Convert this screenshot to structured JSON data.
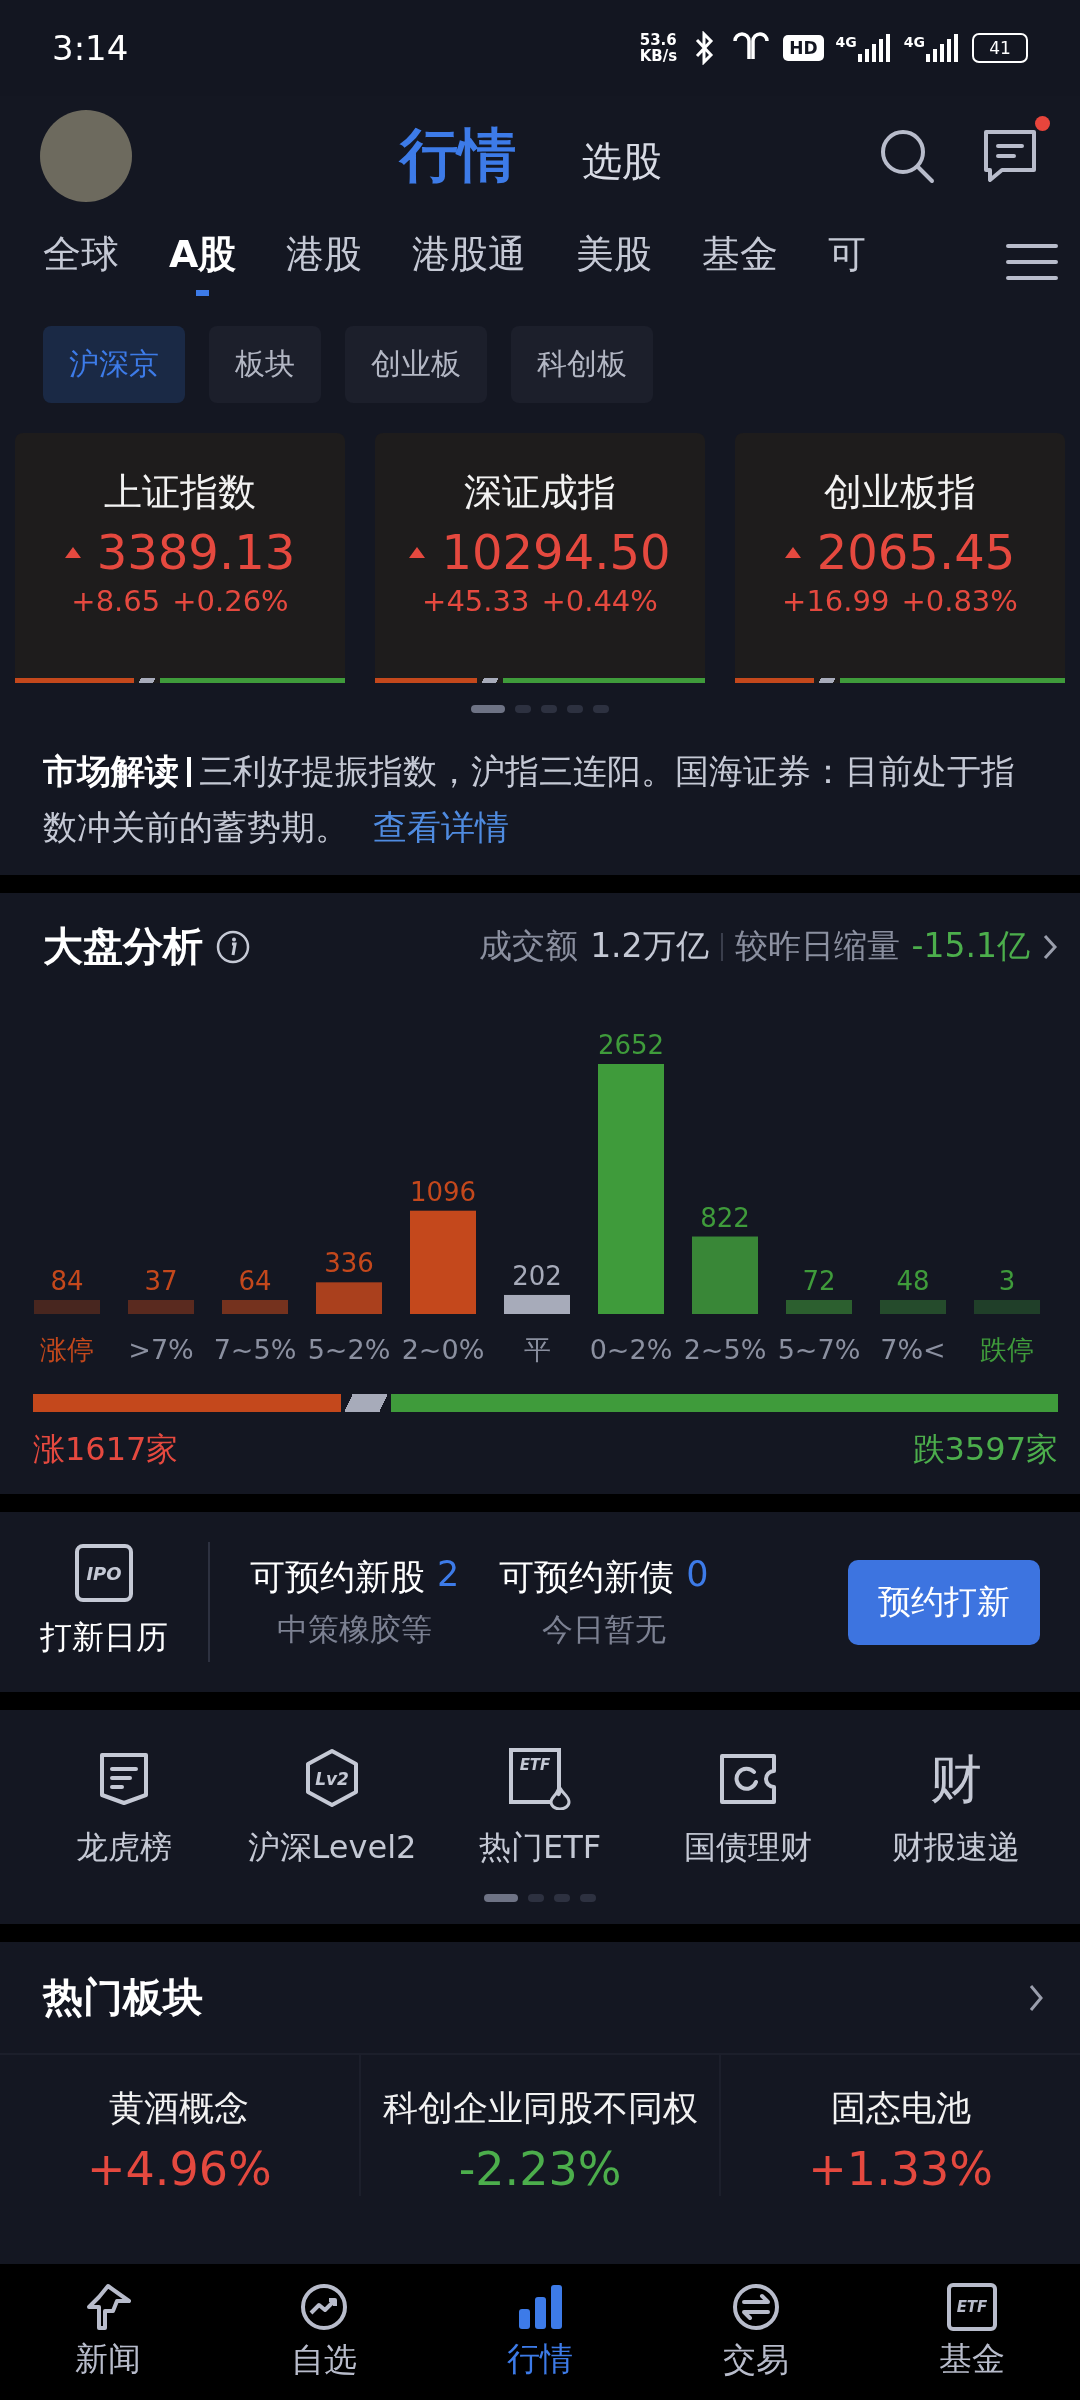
{
  "status_bar": {
    "time": "3:14",
    "speed_value": "53.6",
    "speed_unit": "KB/s",
    "hd_badge": "HD",
    "network_1": "4G",
    "network_2": "4G",
    "battery": "41"
  },
  "header": {
    "tabs": [
      {
        "label": "行情",
        "selected": true
      },
      {
        "label": "选股",
        "selected": false
      }
    ],
    "messages_unread": true
  },
  "market_tabs": [
    {
      "label": "全球",
      "selected": false
    },
    {
      "label": "A股",
      "selected": true
    },
    {
      "label": "港股",
      "selected": false
    },
    {
      "label": "港股通",
      "selected": false
    },
    {
      "label": "美股",
      "selected": false
    },
    {
      "label": "基金",
      "selected": false
    },
    {
      "label": "可",
      "selected": false
    }
  ],
  "sub_tabs": [
    {
      "label": "沪深京",
      "selected": true
    },
    {
      "label": "板块",
      "selected": false
    },
    {
      "label": "创业板",
      "selected": false
    },
    {
      "label": "科创板",
      "selected": false
    }
  ],
  "index_cards": [
    {
      "name": "上证指数",
      "kind": "up",
      "price": "3389.13",
      "change": "+8.65",
      "percent": "+0.26%",
      "breadth": {
        "level": 0.36
      }
    },
    {
      "name": "深证成指",
      "kind": "up",
      "price": "10294.50",
      "change": "+45.33",
      "percent": "+0.44%",
      "breadth": {
        "level": 0.31
      }
    },
    {
      "name": "创业板指",
      "kind": "up",
      "price": "2065.45",
      "change": "+16.99",
      "percent": "+0.83%",
      "breadth": {
        "level": 0.24
      }
    }
  ],
  "card_pager": [
    {
      "selected": true
    },
    {
      "selected": false
    },
    {
      "selected": false
    },
    {
      "selected": false
    },
    {
      "selected": false
    }
  ],
  "market_reading": {
    "title": "市场解读",
    "text": "三利好提振指数，沪指三连阳。国海证券：目前处于指数冲关前的蓄势期。",
    "link": "查看详情"
  },
  "analysis": {
    "title": "大盘分析",
    "turnover_label": "成交额",
    "turnover": "1.2万亿",
    "change_label": "较昨日缩量",
    "change": "-15.1亿",
    "distribution": [
      {
        "range": "涨停",
        "count": "84"
      },
      {
        "range": ">7%",
        "count": "37"
      },
      {
        "range": "7~5%",
        "count": "64"
      },
      {
        "range": "5~2%",
        "count": "336"
      },
      {
        "range": "2~0%",
        "count": "1096"
      },
      {
        "range": "平",
        "count": "202"
      },
      {
        "range": "0~2%",
        "count": "2652"
      },
      {
        "range": "2~5%",
        "count": "822"
      },
      {
        "range": "5~7%",
        "count": "72"
      },
      {
        "range": "7%<",
        "count": "48"
      },
      {
        "range": "跌停",
        "count": "3"
      }
    ],
    "breadth": {
      "level": 0.3
    },
    "up_count": "涨1617家",
    "down_count": "跌3597家"
  },
  "ipo": {
    "icon_text": "IPO",
    "calendar_label": "打新日历",
    "items": [
      {
        "label": "可预约新股",
        "count": "2",
        "note": "中策橡胶等"
      },
      {
        "label": "可预约新债",
        "count": "0",
        "note": "今日暂无"
      }
    ],
    "button": "预约打新"
  },
  "shortcuts": [
    {
      "kind": "list",
      "label": "龙虎榜"
    },
    {
      "kind": "hex",
      "icon_text": "Lv2",
      "label": "沪深Level2"
    },
    {
      "kind": "etf",
      "icon_text": "ETF",
      "label": "热门ETF"
    },
    {
      "kind": "coupon",
      "label": "国债理财"
    },
    {
      "kind": "glyph",
      "icon_text": "财",
      "label": "财报速递"
    }
  ],
  "shortcut_pager": [
    {
      "selected": true
    },
    {
      "selected": false
    },
    {
      "selected": false
    },
    {
      "selected": false
    }
  ],
  "hot_sectors": {
    "title": "热门板块",
    "items": [
      {
        "name": "黄酒概念",
        "change": "+4.96%",
        "kind": "up"
      },
      {
        "name": "科创企业同股不同权",
        "change": "-2.23%",
        "kind": "down"
      },
      {
        "name": "固态电池",
        "change": "+1.33%",
        "kind": "up"
      }
    ]
  },
  "bottom_nav": [
    {
      "kind": "news",
      "label": "新闻",
      "selected": false
    },
    {
      "kind": "watch",
      "label": "自选",
      "selected": false
    },
    {
      "kind": "market",
      "label": "行情",
      "selected": true
    },
    {
      "kind": "trade",
      "label": "交易",
      "selected": false
    },
    {
      "kind": "fund",
      "icon_text": "ETF",
      "label": "基金",
      "selected": false
    }
  ]
}
